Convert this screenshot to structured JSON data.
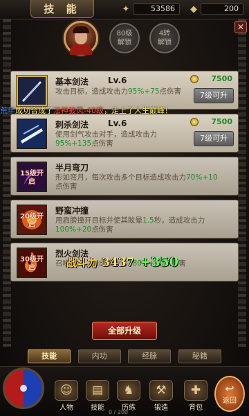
{
  "header": {
    "title": "技 能",
    "gold_icon": "coin-bag-icon",
    "gold": "53586",
    "ingot_icon": "ingot-icon",
    "ingot": "200",
    "close_label": "✕"
  },
  "top": {
    "lock1": {
      "line1": "80级",
      "line2": "解锁"
    },
    "lock2": {
      "line1": "4转",
      "line2": "解锁"
    }
  },
  "skills": [
    {
      "name": "基本剑法",
      "level": "Lv.6",
      "desc_a": "攻击目标，造成攻击力",
      "desc_b": "95%+75",
      "desc_c": "点伤害",
      "cost": "7500",
      "button": "7级可升"
    },
    {
      "name": "刺杀剑法",
      "level": "Lv.6",
      "desc_a": "使用剑气攻击对手，造成攻击力",
      "desc_b": "95%+135",
      "desc_c": "点伤害",
      "cost": "7500",
      "button": "7级可升"
    },
    {
      "name": "半月弯刀",
      "desc_a": "形如弯月，每次攻击多个目标造成攻击力",
      "desc_b": "70%+10",
      "desc_c": "点伤害",
      "lock": "15级开启"
    },
    {
      "name": "野蛮冲撞",
      "desc_a": "用肩膀撞开目标并使其眩晕",
      "desc_b": "1.5",
      "desc_c": "秒，造成攻击力",
      "desc_d": "100%+20",
      "desc_e": "点伤害",
      "lock": "20级开启"
    },
    {
      "name": "烈火剑法",
      "desc_a": "召唤烈火，造成攻击力",
      "desc_b": "180%+40",
      "desc_c": "点伤害",
      "lock": "30级开启"
    }
  ],
  "broadcast": {
    "part1": "荒年",
    "part2": "成功合成了",
    "part3": "法神披风-40级",
    "part4": "，走上了人生巅峰！"
  },
  "combat": {
    "label": "战斗力",
    "value": "3437",
    "delta": "+350"
  },
  "all_upgrade": "全部升级",
  "tabs": [
    "技能",
    "内功",
    "经脉",
    "秘籍"
  ],
  "bottom_menu": [
    {
      "label": "人物",
      "icon": "character-icon"
    },
    {
      "label": "技能",
      "icon": "skill-book-icon"
    },
    {
      "label": "历练",
      "icon": "training-icon"
    },
    {
      "label": "锻造",
      "icon": "anvil-icon"
    },
    {
      "label": "背包",
      "icon": "bag-icon"
    }
  ],
  "exp": "0 / 200",
  "back_label": "返回"
}
